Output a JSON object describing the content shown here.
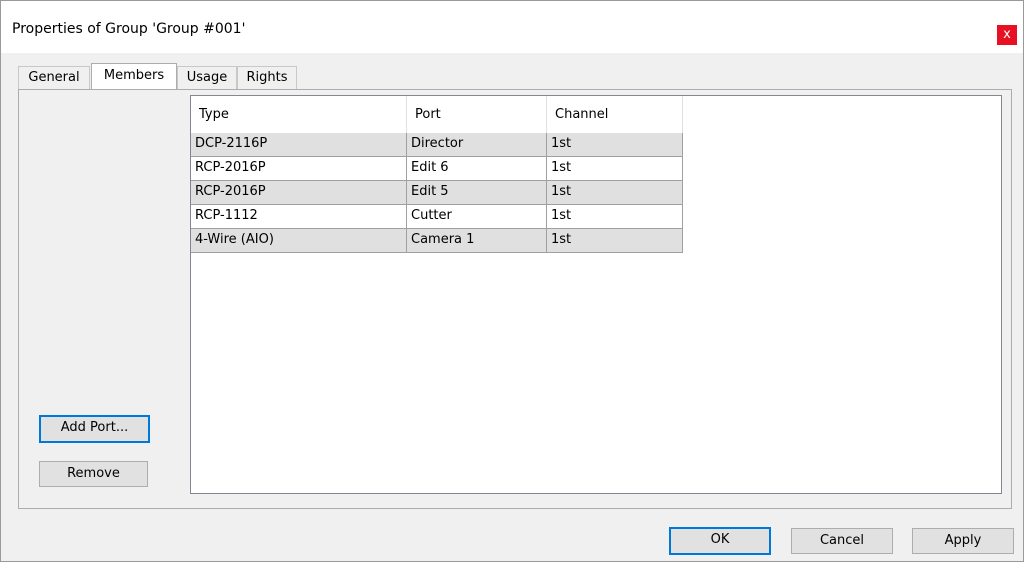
{
  "window": {
    "title": "Properties of Group 'Group #001'",
    "close_glyph": "x"
  },
  "tabs": [
    {
      "label": "General",
      "active": false
    },
    {
      "label": "Members",
      "active": true
    },
    {
      "label": "Usage",
      "active": false
    },
    {
      "label": "Rights",
      "active": false
    }
  ],
  "members": {
    "add_port_label": "Add Port...",
    "remove_label": "Remove",
    "columns": [
      "Type",
      "Port",
      "Channel"
    ],
    "rows": [
      {
        "type": "DCP-2116P",
        "port": "Director",
        "channel": "1st"
      },
      {
        "type": "RCP-2016P",
        "port": "Edit 6",
        "channel": "1st"
      },
      {
        "type": "RCP-2016P",
        "port": "Edit 5",
        "channel": "1st"
      },
      {
        "type": "RCP-1112",
        "port": "Cutter",
        "channel": "1st"
      },
      {
        "type": "4-Wire (AIO)",
        "port": "Camera 1",
        "channel": "1st"
      }
    ]
  },
  "footer": {
    "ok_label": "OK",
    "cancel_label": "Cancel",
    "apply_label": "Apply"
  },
  "colors": {
    "close_button": "#e81123",
    "focus_border": "#0078d7",
    "dialog_background": "#f0f0f0",
    "row_stripe": "#e0e0e0"
  }
}
